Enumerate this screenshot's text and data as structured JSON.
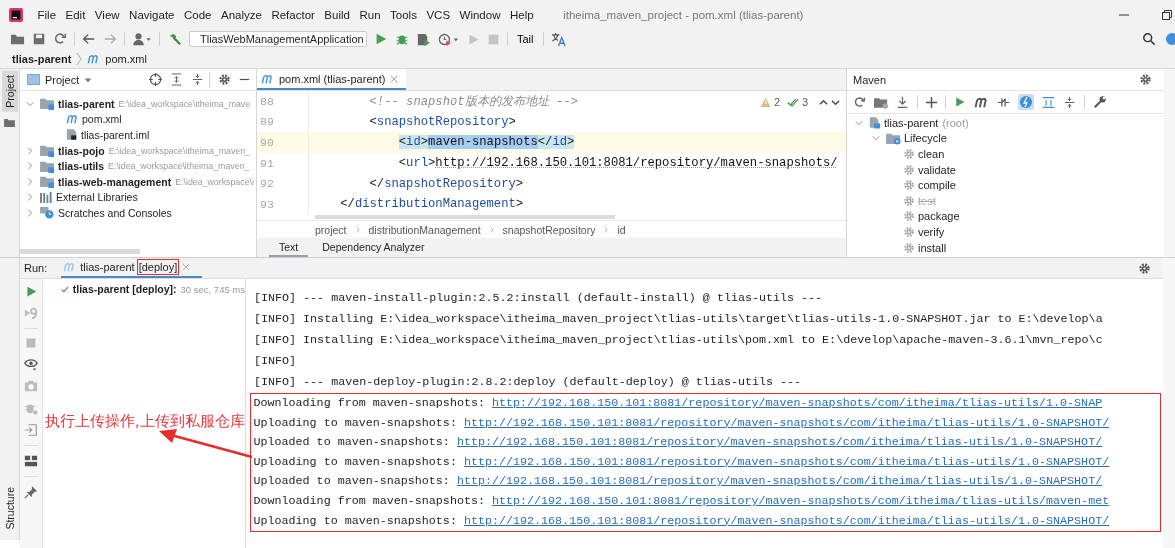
{
  "window": {
    "title": "itheima_maven_project - pom.xml (tlias-parent)"
  },
  "menu": [
    "File",
    "Edit",
    "View",
    "Navigate",
    "Code",
    "Analyze",
    "Refactor",
    "Build",
    "Run",
    "Tools",
    "VCS",
    "Window",
    "Help"
  ],
  "toolbar": {
    "run_config": "TliasWebManagementApplication",
    "tail": "Tail"
  },
  "navigation": {
    "project": "tlias-parent",
    "file": "pom.xml"
  },
  "side_tabs": {
    "top": "Project",
    "bottom": "Structure"
  },
  "project": {
    "title": "Project",
    "tree": [
      {
        "kind": "module",
        "name": "tlias-parent",
        "path": "E:\\idea_workspace\\itheima_mave",
        "expanded": true,
        "children": [
          {
            "kind": "pom",
            "name": "pom.xml"
          },
          {
            "kind": "iml",
            "name": "tlias-parent.iml"
          }
        ]
      },
      {
        "kind": "module",
        "name": "tlias-pojo",
        "path": "E:\\idea_workspace\\itheima_maven_",
        "expanded": false
      },
      {
        "kind": "module",
        "name": "tlias-utils",
        "path": "E:\\idea_workspace\\itheima_maven_",
        "expanded": false
      },
      {
        "kind": "module",
        "name": "tlias-web-management",
        "path": "E:\\idea_workspace\\i",
        "expanded": false
      },
      {
        "kind": "libraries",
        "name": "External Libraries",
        "expanded": false
      },
      {
        "kind": "scratches",
        "name": "Scratches and Consoles",
        "expanded": false
      }
    ]
  },
  "editor": {
    "tab": "pom.xml (tlias-parent)",
    "warnings": "2",
    "checks": "3",
    "lines": [
      {
        "number": "88",
        "current": false,
        "segments": [
          {
            "kind": "comment",
            "text": "        <!-- snapshot版本的发布地址 -->"
          }
        ]
      },
      {
        "number": "89",
        "current": false,
        "segments": [
          {
            "kind": "punct",
            "text": "        <"
          },
          {
            "kind": "tag",
            "text": "snapshotRepository"
          },
          {
            "kind": "punct",
            "text": ">"
          }
        ]
      },
      {
        "number": "90",
        "current": true,
        "segments": [
          {
            "kind": "punct",
            "text": "            <",
            "highlighted": true
          },
          {
            "kind": "tag",
            "text": "id",
            "highlighted": true
          },
          {
            "kind": "punct",
            "text": ">",
            "highlighted": true
          },
          {
            "kind": "text",
            "text": "maven-snapshots",
            "selected": true
          },
          {
            "kind": "punct",
            "text": "</",
            "highlighted": true
          },
          {
            "kind": "tag",
            "text": "id",
            "highlighted": true
          },
          {
            "kind": "punct",
            "text": ">",
            "highlighted": true
          }
        ]
      },
      {
        "number": "91",
        "current": false,
        "segments": [
          {
            "kind": "punct",
            "text": "            <"
          },
          {
            "kind": "tag",
            "text": "url"
          },
          {
            "kind": "punct",
            "text": ">"
          },
          {
            "kind": "url",
            "text": "http://192.168.150.101:8081/repository/maven-snapshots/"
          }
        ]
      },
      {
        "number": "92",
        "current": false,
        "segments": [
          {
            "kind": "punct",
            "text": "        </"
          },
          {
            "kind": "tag",
            "text": "snapshotRepository"
          },
          {
            "kind": "punct",
            "text": ">"
          }
        ]
      },
      {
        "number": "93",
        "current": false,
        "segments": [
          {
            "kind": "punct",
            "text": "    </"
          },
          {
            "kind": "tag",
            "text": "distributionManagement"
          },
          {
            "kind": "punct",
            "text": ">"
          }
        ]
      }
    ],
    "breadcrumbs": [
      "project",
      "distributionManagement",
      "snapshotRepository",
      "id"
    ],
    "bottom_tabs": [
      {
        "label": "Text",
        "selected": true
      },
      {
        "label": "Dependency Analyzer",
        "selected": false
      }
    ]
  },
  "maven": {
    "title": "Maven",
    "tree": [
      {
        "kind": "project",
        "name": "tlias-parent",
        "suffix": "(root)",
        "expanded": true,
        "children": [
          {
            "kind": "lifecycle",
            "name": "Lifecycle",
            "expanded": true,
            "children": [
              {
                "kind": "goal",
                "name": "clean",
                "skipped": false
              },
              {
                "kind": "goal",
                "name": "validate",
                "skipped": false
              },
              {
                "kind": "goal",
                "name": "compile",
                "skipped": false
              },
              {
                "kind": "goal",
                "name": "test",
                "skipped": true
              },
              {
                "kind": "goal",
                "name": "package",
                "skipped": false
              },
              {
                "kind": "goal",
                "name": "verify",
                "skipped": false
              },
              {
                "kind": "goal",
                "name": "install",
                "skipped": false
              }
            ]
          }
        ]
      }
    ]
  },
  "run": {
    "label": "Run:",
    "tab": {
      "name": "tlias-parent",
      "config": "[deploy]"
    },
    "tree": [
      {
        "name": "tlias-parent [deploy]:",
        "time": "30 sec, 745 ms",
        "passed": true
      }
    ],
    "console": [
      {
        "text": "[INFO] --- maven-install-plugin:2.5.2:install (default-install) @ tlias-utils ---"
      },
      {
        "text": "[INFO] Installing E:\\idea_workspace\\itheima_maven_project\\tlias-utils\\target\\tlias-utils-1.0-SNAPSHOT.jar to E:\\develop\\a"
      },
      {
        "text": "[INFO] Installing E:\\idea_workspace\\itheima_maven_project\\tlias-utils\\pom.xml to E:\\develop\\apache-maven-3.6.1\\mvn_repo\\c"
      },
      {
        "text": "[INFO]"
      },
      {
        "text": "[INFO] --- maven-deploy-plugin:2.8.2:deploy (default-deploy) @ tlias-utils ---"
      }
    ],
    "transfers": [
      {
        "text": "Downloading from maven-snapshots: ",
        "link": "http://192.168.150.101:8081/repository/maven-snapshots/com/itheima/tlias-utils/1.0-SNAP"
      },
      {
        "text": "Uploading to maven-snapshots: ",
        "link": "http://192.168.150.101:8081/repository/maven-snapshots/com/itheima/tlias-utils/1.0-SNAPSHOT/"
      },
      {
        "text": "Uploaded to maven-snapshots: ",
        "link": "http://192.168.150.101:8081/repository/maven-snapshots/com/itheima/tlias-utils/1.0-SNAPSHOT/"
      },
      {
        "text": "Uploading to maven-snapshots: ",
        "link": "http://192.168.150.101:8081/repository/maven-snapshots/com/itheima/tlias-utils/1.0-SNAPSHOT/"
      },
      {
        "text": "Uploaded to maven-snapshots: ",
        "link": "http://192.168.150.101:8081/repository/maven-snapshots/com/itheima/tlias-utils/1.0-SNAPSHOT/"
      },
      {
        "text": "Downloading from maven-snapshots: ",
        "link": "http://192.168.150.101:8081/repository/maven-snapshots/com/itheima/tlias-utils/maven-met"
      },
      {
        "text": "Uploading to maven-snapshots: ",
        "link": "http://192.168.150.101:8081/repository/maven-snapshots/com/itheima/tlias-utils/1.0-SNAPSHOT/"
      }
    ]
  },
  "annotation": {
    "text": "执行上传操作,上传到私服仓库"
  }
}
